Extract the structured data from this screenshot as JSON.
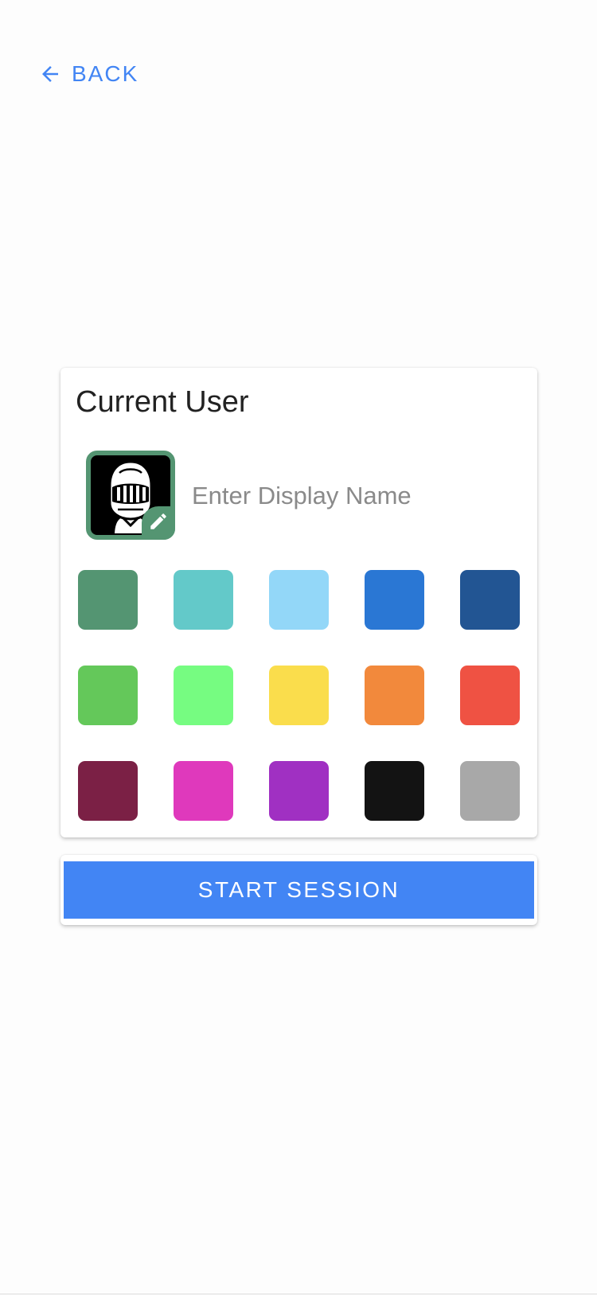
{
  "nav": {
    "back_label": "BACK",
    "back_icon": "arrow-left-icon"
  },
  "card": {
    "title": "Current User",
    "avatar_icon": "knight-helmet-icon",
    "avatar_border_color": "#549572",
    "edit_icon": "pencil-icon",
    "name_placeholder": "Enter Display Name",
    "name_value": ""
  },
  "swatches": [
    {
      "name": "sea-green",
      "color": "#549572"
    },
    {
      "name": "teal",
      "color": "#63c9c9"
    },
    {
      "name": "light-sky-blue",
      "color": "#93d7f8"
    },
    {
      "name": "blue",
      "color": "#2a77d4"
    },
    {
      "name": "dark-blue",
      "color": "#225593"
    },
    {
      "name": "green",
      "color": "#64c85a"
    },
    {
      "name": "light-green",
      "color": "#76fc81"
    },
    {
      "name": "yellow",
      "color": "#fadd4c"
    },
    {
      "name": "orange",
      "color": "#f2893c"
    },
    {
      "name": "red",
      "color": "#ef5243"
    },
    {
      "name": "maroon",
      "color": "#7b2045"
    },
    {
      "name": "magenta",
      "color": "#df39bc"
    },
    {
      "name": "purple",
      "color": "#a030c2"
    },
    {
      "name": "black",
      "color": "#131313"
    },
    {
      "name": "gray",
      "color": "#a8a8a8"
    }
  ],
  "actions": {
    "start_label": "START SESSION"
  },
  "theme": {
    "accent": "#4285f4",
    "title_color": "#222222"
  }
}
